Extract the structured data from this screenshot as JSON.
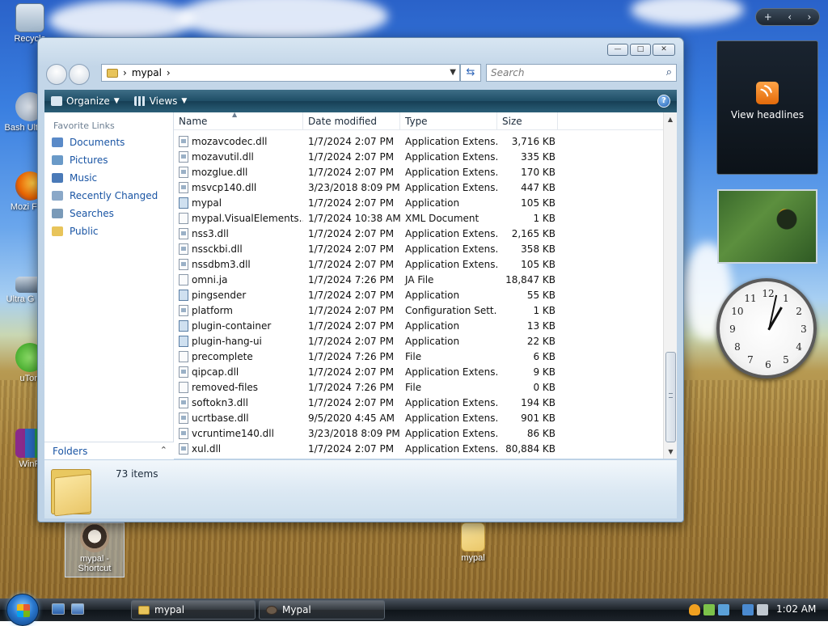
{
  "desktop": {
    "icons": [
      {
        "label": "Recycle"
      },
      {
        "label": "Bash Ultra G"
      },
      {
        "label": "Mozi Firef"
      },
      {
        "label": "Ultra G Fish"
      },
      {
        "label": "uTorr"
      },
      {
        "label": "WinR"
      },
      {
        "label": "mypal - Shortcut"
      },
      {
        "label": "mypal"
      }
    ]
  },
  "window": {
    "caption": {
      "minimize": "—",
      "maximize": "□",
      "close": "✕"
    },
    "address": {
      "path": "mypal"
    },
    "search_placeholder": "Search",
    "toolbar": {
      "organize": "Organize",
      "views": "Views",
      "help": "?"
    },
    "nav": {
      "favorites_title": "Favorite Links",
      "links": [
        "Documents",
        "Pictures",
        "Music",
        "Recently Changed",
        "Searches",
        "Public"
      ],
      "folders": "Folders"
    },
    "columns": [
      "Name",
      "Date modified",
      "Type",
      "Size"
    ],
    "files": [
      {
        "name": "mozavcodec.dll",
        "date": "1/7/2024 2:07 PM",
        "type": "Application Extens...",
        "size": "3,716 KB",
        "icon": "dll"
      },
      {
        "name": "mozavutil.dll",
        "date": "1/7/2024 2:07 PM",
        "type": "Application Extens...",
        "size": "335 KB",
        "icon": "dll"
      },
      {
        "name": "mozglue.dll",
        "date": "1/7/2024 2:07 PM",
        "type": "Application Extens...",
        "size": "170 KB",
        "icon": "dll"
      },
      {
        "name": "msvcp140.dll",
        "date": "3/23/2018 8:09 PM",
        "type": "Application Extens...",
        "size": "447 KB",
        "icon": "dll"
      },
      {
        "name": "mypal",
        "date": "1/7/2024 2:07 PM",
        "type": "Application",
        "size": "105 KB",
        "icon": "app"
      },
      {
        "name": "mypal.VisualElements...",
        "date": "1/7/2024 10:38 AM",
        "type": "XML Document",
        "size": "1 KB",
        "icon": "file"
      },
      {
        "name": "nss3.dll",
        "date": "1/7/2024 2:07 PM",
        "type": "Application Extens...",
        "size": "2,165 KB",
        "icon": "dll"
      },
      {
        "name": "nssckbi.dll",
        "date": "1/7/2024 2:07 PM",
        "type": "Application Extens...",
        "size": "358 KB",
        "icon": "dll"
      },
      {
        "name": "nssdbm3.dll",
        "date": "1/7/2024 2:07 PM",
        "type": "Application Extens...",
        "size": "105 KB",
        "icon": "dll"
      },
      {
        "name": "omni.ja",
        "date": "1/7/2024 7:26 PM",
        "type": "JA File",
        "size": "18,847 KB",
        "icon": "file"
      },
      {
        "name": "pingsender",
        "date": "1/7/2024 2:07 PM",
        "type": "Application",
        "size": "55 KB",
        "icon": "app"
      },
      {
        "name": "platform",
        "date": "1/7/2024 2:07 PM",
        "type": "Configuration Sett...",
        "size": "1 KB",
        "icon": "dll"
      },
      {
        "name": "plugin-container",
        "date": "1/7/2024 2:07 PM",
        "type": "Application",
        "size": "13 KB",
        "icon": "app"
      },
      {
        "name": "plugin-hang-ui",
        "date": "1/7/2024 2:07 PM",
        "type": "Application",
        "size": "22 KB",
        "icon": "app"
      },
      {
        "name": "precomplete",
        "date": "1/7/2024 7:26 PM",
        "type": "File",
        "size": "6 KB",
        "icon": "file"
      },
      {
        "name": "qipcap.dll",
        "date": "1/7/2024 2:07 PM",
        "type": "Application Extens...",
        "size": "9 KB",
        "icon": "dll"
      },
      {
        "name": "removed-files",
        "date": "1/7/2024 7:26 PM",
        "type": "File",
        "size": "0 KB",
        "icon": "file"
      },
      {
        "name": "softokn3.dll",
        "date": "1/7/2024 2:07 PM",
        "type": "Application Extens...",
        "size": "194 KB",
        "icon": "dll"
      },
      {
        "name": "ucrtbase.dll",
        "date": "9/5/2020 4:45 AM",
        "type": "Application Extens...",
        "size": "901 KB",
        "icon": "dll"
      },
      {
        "name": "vcruntime140.dll",
        "date": "3/23/2018 8:09 PM",
        "type": "Application Extens...",
        "size": "86 KB",
        "icon": "dll"
      },
      {
        "name": "xul.dll",
        "date": "1/7/2024 2:07 PM",
        "type": "Application Extens...",
        "size": "80,884 KB",
        "icon": "dll"
      }
    ],
    "details": {
      "count": "73 items"
    }
  },
  "sidebar": {
    "controls": {
      "add": "+",
      "prev": "‹",
      "next": "›"
    },
    "headlines": "View headlines",
    "clock_numbers": [
      "12",
      "1",
      "2",
      "3",
      "4",
      "5",
      "6",
      "7",
      "8",
      "9",
      "10",
      "11"
    ]
  },
  "taskbar": {
    "buttons": [
      "mypal",
      "Mypal"
    ],
    "time": "1:02 AM"
  }
}
